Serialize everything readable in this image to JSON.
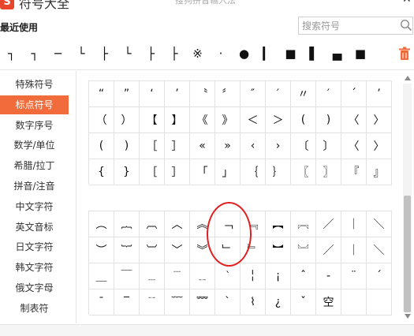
{
  "app": {
    "logo_char": "S",
    "title": "符号大全",
    "subtitle": "搜狗拼音输入法"
  },
  "recent": {
    "label": "最近使用",
    "symbols": [
      "┐",
      "┐",
      "─",
      "└",
      "├",
      "└",
      "├",
      "├",
      "※",
      "·",
      "●",
      "▎",
      "■",
      "▌",
      "▄",
      "■"
    ]
  },
  "search": {
    "placeholder": "搜索符号"
  },
  "sidebar": {
    "items": [
      {
        "label": "特殊符号"
      },
      {
        "label": "标点符号"
      },
      {
        "label": "数字序号"
      },
      {
        "label": "数学/单位"
      },
      {
        "label": "希腊/拉丁"
      },
      {
        "label": "拼音/注音"
      },
      {
        "label": "中文字符"
      },
      {
        "label": "英文音标"
      },
      {
        "label": "日文字符"
      },
      {
        "label": "韩文字符"
      },
      {
        "label": "俄文字母"
      },
      {
        "label": "制表符"
      }
    ],
    "active_index": 1
  },
  "grid1": {
    "rows": [
      [
        "“",
        "”",
        "‘",
        "’",
        "〝",
        "〞",
        "″",
        "′",
        "〃",
        "′",
        "´",
        "’"
      ],
      [
        "（",
        "）",
        "【",
        "】",
        "《",
        "》",
        "＜",
        "＞",
        "(",
        ")",
        "〈",
        "〉"
      ],
      [
        "(",
        ")",
        "［",
        "］",
        "«",
        "»",
        "‹",
        "›",
        "〔",
        "〕",
        "〈",
        "〉"
      ],
      [
        "{",
        "}",
        "［",
        "］",
        "「",
        "」",
        "｛",
        "｝",
        "〖",
        "〗",
        "『",
        "』"
      ]
    ]
  },
  "grid2": {
    "rows": [
      [
        "︵",
        "︷",
        "︹",
        "︿",
        "︽",
        "﹁",
        "﹃",
        "︻",
        "︗",
        "／",
        "｜",
        "＼"
      ],
      [
        "︶",
        "︸",
        "︺",
        "﹀",
        "︾",
        "﹂",
        "﹄",
        "︼",
        "︘",
        "／",
        "｜",
        "＼"
      ],
      [
        "＿",
        "￣",
        "﹍",
        "﹉",
        "﹎",
        "‵",
        "╎",
        "¡",
        "ˆ",
        "‐",
        "¨",
        "ˊ"
      ],
      [
        "ˉ",
        "‾",
        "﹊",
        "﹋",
        "﹌",
        "ˋ",
        "⌇",
        "¿",
        "ˇ",
        "空",
        "",
        ""
      ]
    ]
  }
}
